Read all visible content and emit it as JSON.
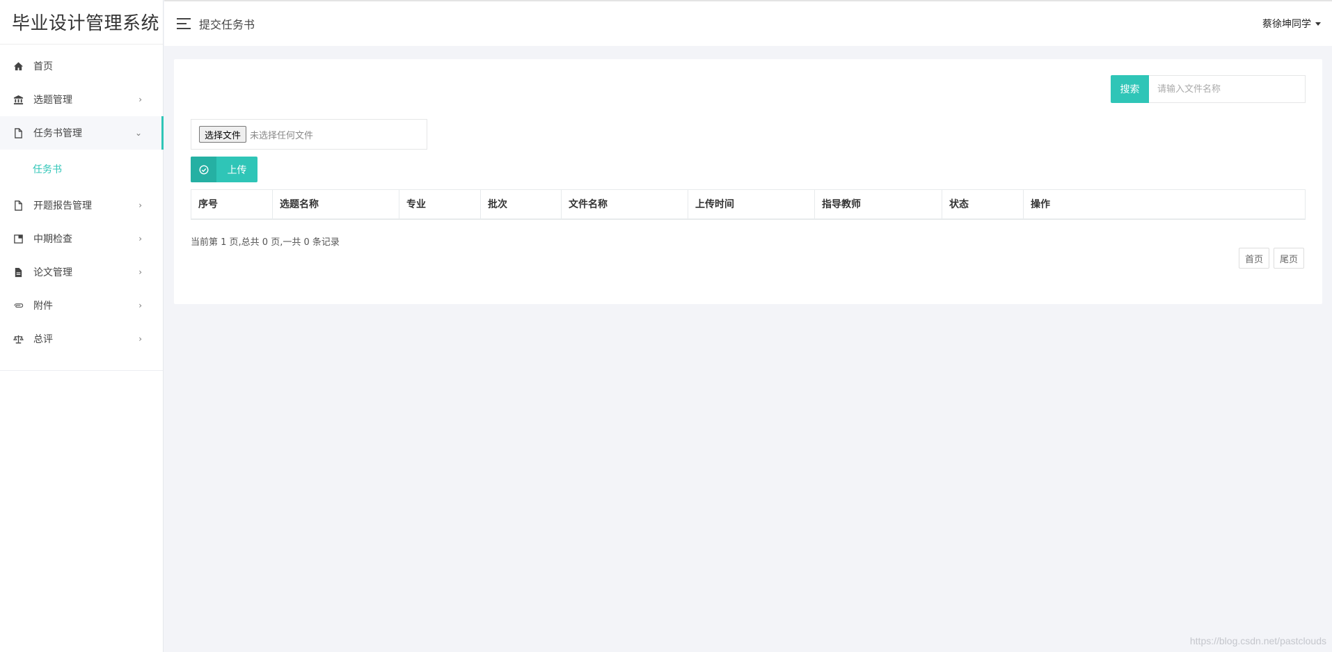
{
  "app": {
    "title": "毕业设计管理系统"
  },
  "header": {
    "page_title": "提交任务书",
    "user_name": "蔡徐坤同学"
  },
  "sidebar": {
    "items": [
      {
        "label": "首页",
        "icon": "home-icon",
        "has_children": false
      },
      {
        "label": "选题管理",
        "icon": "bank-icon",
        "has_children": true
      },
      {
        "label": "任务书管理",
        "icon": "file-icon",
        "has_children": true,
        "expanded": true,
        "active": true
      },
      {
        "label": "开题报告管理",
        "icon": "file-icon",
        "has_children": true
      },
      {
        "label": "中期检查",
        "icon": "notebook-icon",
        "has_children": true
      },
      {
        "label": "论文管理",
        "icon": "document-icon",
        "has_children": true
      },
      {
        "label": "附件",
        "icon": "paperclip-icon",
        "has_children": true
      },
      {
        "label": "总评",
        "icon": "balance-scale-icon",
        "has_children": true
      }
    ],
    "sub_items": [
      {
        "label": "任务书",
        "parent": "任务书管理"
      }
    ]
  },
  "search": {
    "button_label": "搜索",
    "placeholder": "请输入文件名称",
    "value": ""
  },
  "upload": {
    "choose_label": "选择文件",
    "file_status": "未选择任何文件",
    "upload_label": "上传"
  },
  "table": {
    "columns": [
      "序号",
      "选题名称",
      "专业",
      "批次",
      "文件名称",
      "上传时间",
      "指导教师",
      "状态",
      "操作"
    ],
    "rows": []
  },
  "pagination": {
    "info": "当前第 1 页,总共 0 页,一共 0 条记录",
    "first_label": "首页",
    "last_label": "尾页"
  },
  "watermark": "https://blog.csdn.net/pastclouds",
  "colors": {
    "accent": "#2fc5b7",
    "accent_dark": "#25b0a3",
    "background": "#f3f4f8"
  }
}
